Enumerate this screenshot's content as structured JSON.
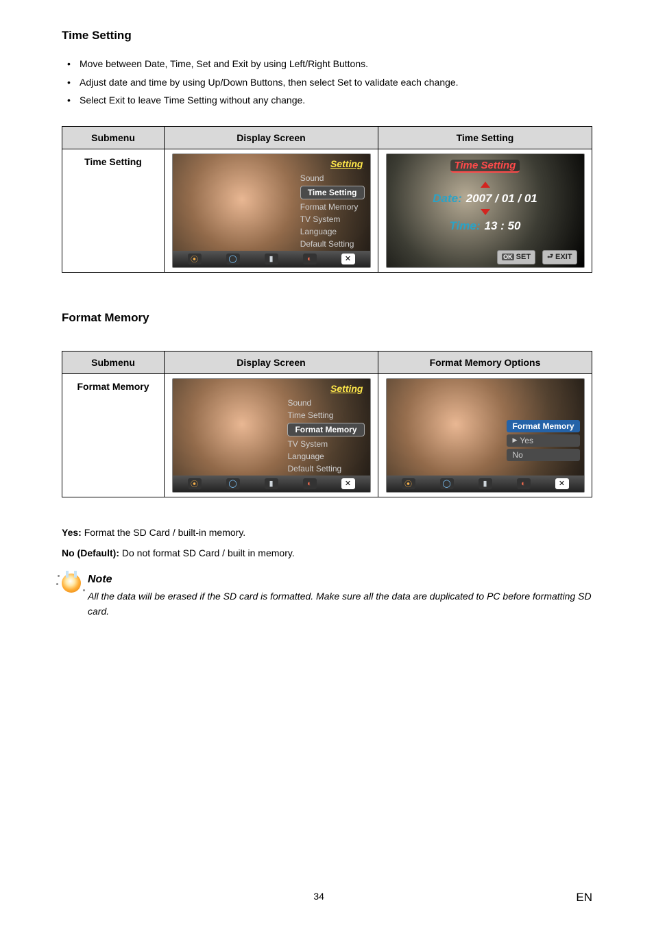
{
  "sections": {
    "timeSetting": {
      "title": "Time Setting",
      "bullets": [
        "Move between Date, Time, Set and Exit by using Left/Right Buttons.",
        "Adjust date and time by using Up/Down Buttons, then select Set to validate each change.",
        "Select Exit to leave Time Setting without any change."
      ],
      "table": {
        "headers": [
          "Submenu",
          "Display Screen",
          "Time Setting"
        ],
        "rowLabel": "Time Setting"
      }
    },
    "formatMemory": {
      "title": "Format Memory",
      "table": {
        "headers": [
          "Submenu",
          "Display Screen",
          "Format Memory Options"
        ],
        "rowLabel": "Format Memory"
      },
      "yesLine": {
        "label": "Yes:",
        "text": " Format the SD Card / built-in memory."
      },
      "noLine": {
        "label": "No (Default):",
        "text": " Do not format SD Card / built in memory."
      }
    }
  },
  "settingMenu": {
    "title": "Setting",
    "items": [
      "Sound",
      "Time Setting",
      "Format Memory",
      "TV System",
      "Language",
      "Default Setting"
    ]
  },
  "timePane": {
    "title": "Time Setting",
    "dateLabel": "Date:",
    "dateValue": "2007 / 01 / 01",
    "timeLabel": "Time:",
    "timeValue": "13 : 50",
    "btnSetPrefix": "OK",
    "btnSet": "SET",
    "btnExit": "EXIT"
  },
  "formatPane": {
    "title": "Format Memory",
    "options": [
      "Yes",
      "No"
    ]
  },
  "note": {
    "heading": "Note",
    "body": "All the data will be erased if the SD card is formatted. Make sure all the data are duplicated to PC before formatting SD card."
  },
  "footer": {
    "page": "34",
    "lang": "EN"
  }
}
